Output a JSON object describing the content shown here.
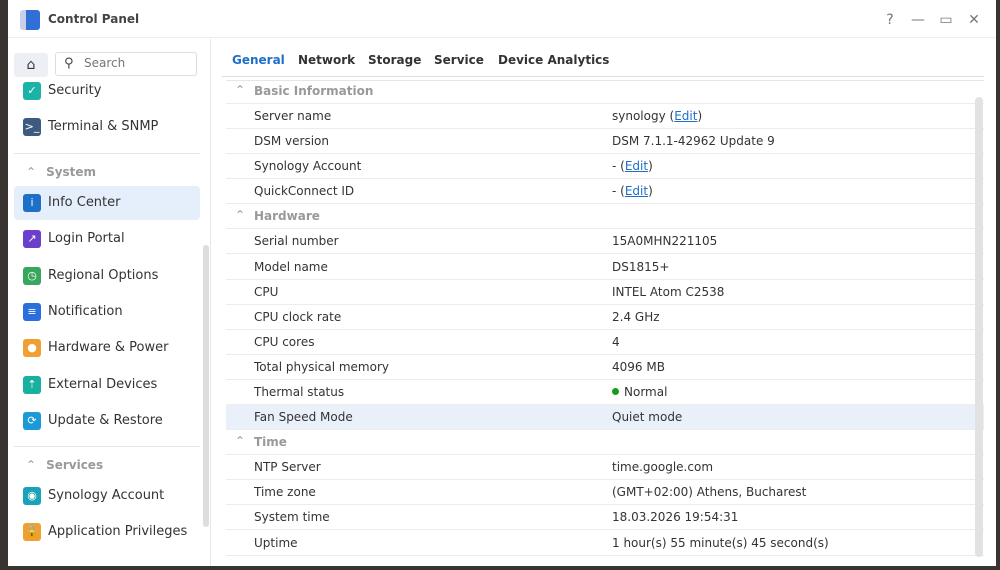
{
  "window": {
    "title": "Control Panel",
    "help": "?",
    "minimize": "—",
    "maximize": "▭",
    "close": "✕"
  },
  "sidebar": {
    "search_placeholder": "Search",
    "top_items": [
      {
        "label": "Security",
        "color": "#1bb3a6",
        "glyph": "✓"
      },
      {
        "label": "Terminal & SNMP",
        "color": "#3d5a80",
        "glyph": ">_"
      }
    ],
    "system_header": "System",
    "system_items": [
      {
        "label": "Info Center",
        "color": "#1d6fc9",
        "glyph": "i"
      },
      {
        "label": "Login Portal",
        "color": "#6b3fc9",
        "glyph": "↗"
      },
      {
        "label": "Regional Options",
        "color": "#3aa55d",
        "glyph": "◷"
      },
      {
        "label": "Notification",
        "color": "#2a6fdc",
        "glyph": "≡"
      },
      {
        "label": "Hardware & Power",
        "color": "#f0a030",
        "glyph": "●"
      },
      {
        "label": "External Devices",
        "color": "#18b0a0",
        "glyph": "⇡"
      },
      {
        "label": "Update & Restore",
        "color": "#1a9ad6",
        "glyph": "⟳"
      }
    ],
    "services_header": "Services",
    "services_items": [
      {
        "label": "Synology Account",
        "color": "#1aa3b5",
        "glyph": "◉"
      },
      {
        "label": "Application Privileges",
        "color": "#f0a030",
        "glyph": "🔒"
      }
    ]
  },
  "tabs": [
    "General",
    "Network",
    "Storage",
    "Service",
    "Device Analytics"
  ],
  "sections": [
    {
      "title": "Basic Information",
      "rows": [
        {
          "label": "Server name",
          "value": "synology",
          "edit": "Edit"
        },
        {
          "label": "DSM version",
          "value": "DSM 7.1.1-42962 Update 9"
        },
        {
          "label": "Synology Account",
          "value": "-",
          "edit": "Edit"
        },
        {
          "label": "QuickConnect ID",
          "value": "-",
          "edit": "Edit"
        }
      ]
    },
    {
      "title": "Hardware",
      "rows": [
        {
          "label": "Serial number",
          "value": "15A0MHN221105"
        },
        {
          "label": "Model name",
          "value": "DS1815+"
        },
        {
          "label": "CPU",
          "value": "INTEL Atom C2538"
        },
        {
          "label": "CPU clock rate",
          "value": "2.4 GHz"
        },
        {
          "label": "CPU cores",
          "value": "4"
        },
        {
          "label": "Total physical memory",
          "value": "4096 MB"
        },
        {
          "label": "Thermal status",
          "value": "Normal",
          "status": "ok"
        },
        {
          "label": "Fan Speed Mode",
          "value": "Quiet mode",
          "highlight": true
        }
      ]
    },
    {
      "title": "Time",
      "rows": [
        {
          "label": "NTP Server",
          "value": "time.google.com"
        },
        {
          "label": "Time zone",
          "value": "(GMT+02:00) Athens, Bucharest"
        },
        {
          "label": "System time",
          "value": "18.03.2026 19:54:31"
        },
        {
          "label": "Uptime",
          "value": "1 hour(s) 55 minute(s) 45 second(s)"
        }
      ]
    }
  ]
}
